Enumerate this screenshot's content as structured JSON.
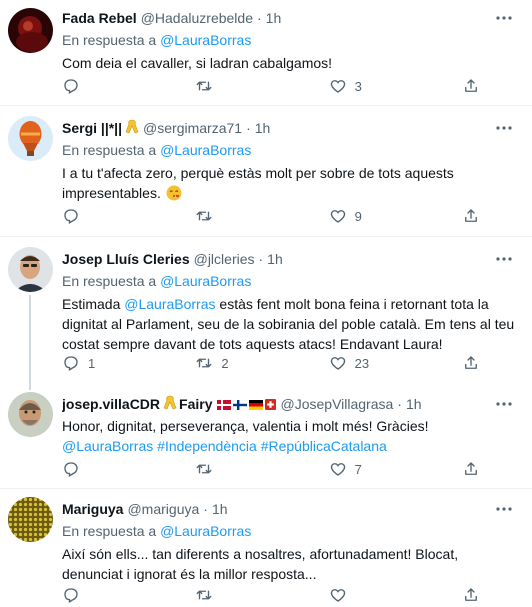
{
  "replying_prefix": "En respuesta a",
  "tweets": [
    {
      "name": "Fada Rebel",
      "handle": "@Hadaluzrebelde",
      "time": "1h",
      "reply_to": "@LauraBorras",
      "text": "Com deia el cavaller, si ladran cabalgamos!",
      "replies": "",
      "retweets": "",
      "likes": "3"
    },
    {
      "name": "Sergi ||*||",
      "handle": "@sergimarza71",
      "time": "1h",
      "reply_to": "@LauraBorras",
      "text": "I a tu t'afecta zero, perquè estàs molt per sobre de tots aquests impresentables.",
      "replies": "",
      "retweets": "",
      "likes": "9"
    },
    {
      "name": "Josep Lluís Cleries",
      "handle": "@jlcleries",
      "time": "1h",
      "reply_to": "@LauraBorras",
      "text_prefix": "Estimada",
      "text_mention": "@LauraBorras",
      "text_rest": "estàs fent molt bona feina i retornant tota la dignitat al Parlament, seu de la sobirania del poble català. Em tens al teu costat sempre davant de tots aquests atacs! Endavant Laura!",
      "replies": "1",
      "retweets": "2",
      "likes": "23"
    },
    {
      "name": "josep.villaCDR",
      "name_suffix": "Fairy",
      "handle": "@JosepVillagrasa",
      "time": "1h",
      "text_main": "Honor, dignitat, perseverança, valentia i molt més! Gràcies!",
      "text_mention": "@LauraBorras",
      "hashtag1": "#Independència",
      "hashtag2": "#RepúblicaCatalana",
      "replies": "",
      "retweets": "",
      "likes": "7"
    },
    {
      "name": "Mariguya",
      "handle": "@mariguya",
      "time": "1h",
      "reply_to": "@LauraBorras",
      "text": "Així són ells... tan diferents a nosaltres, afortunadament! Blocat, denunciat i ignorat és la millor resposta...",
      "replies": "",
      "retweets": "",
      "likes": ""
    }
  ],
  "colors": {
    "link": "#1d9bf0",
    "secondary_text": "#536471",
    "separator": "#eff3f4",
    "thread_line": "#cfd9de",
    "ribbon": "#f4c430"
  },
  "icons": [
    "more-icon",
    "reply-icon",
    "retweet-icon",
    "like-icon",
    "share-icon",
    "yellow-ribbon-icon",
    "kiss-emoji-icon"
  ]
}
